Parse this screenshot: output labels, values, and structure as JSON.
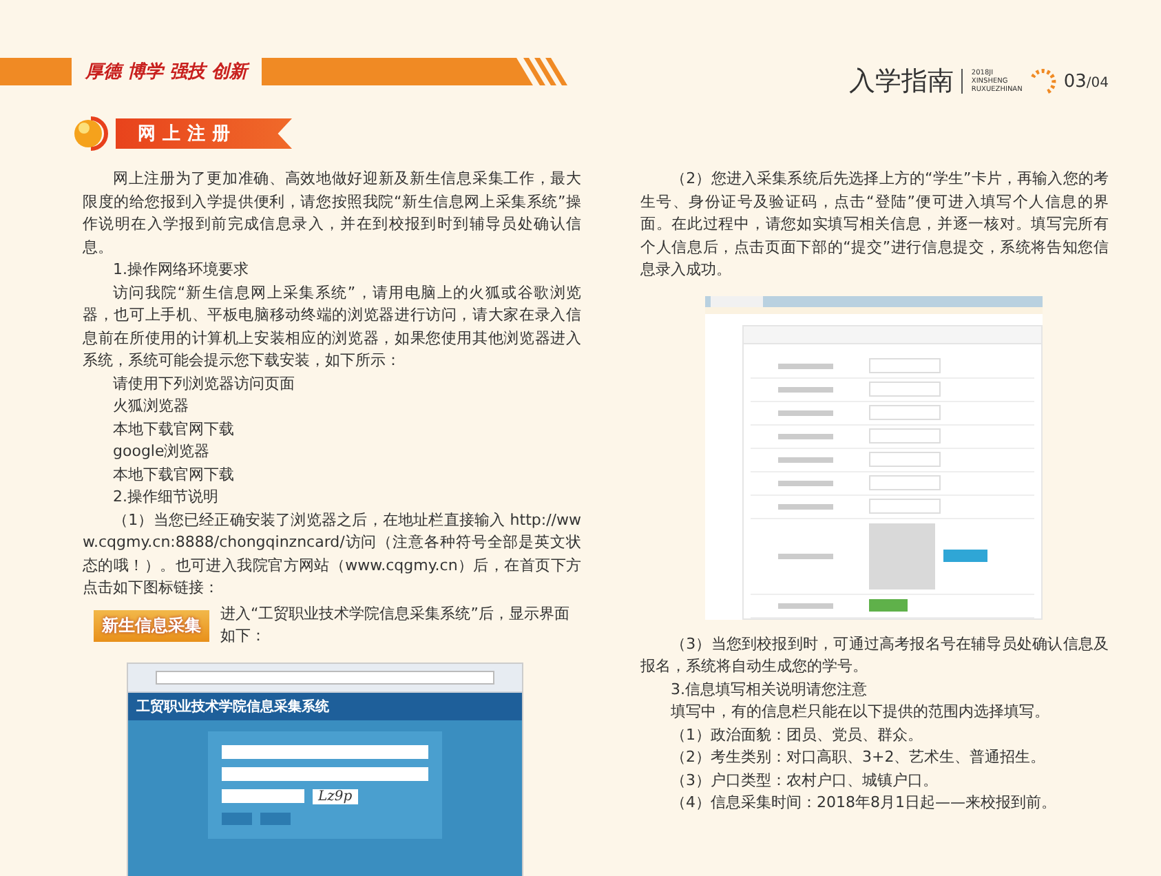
{
  "header": {
    "slogan": "厚德 博学 强技 创新",
    "guide_title": "入学指南",
    "guide_subtitle": [
      "2018JI",
      "XINSHENG",
      "RUXUEZHINAN"
    ],
    "page": "03",
    "page_total": "/04"
  },
  "section_title": "网上注册",
  "left_blocks": [
    {
      "kind": "text",
      "text": "网上注册为了更加准确、高效地做好迎新及新生信息采集工作，最大限度的给您报到入学提供便利，请您按照我院“新生信息网上采集系统”操作说明在入学报到前完成信息录入，并在到校报到时到辅导员处确认信息。"
    },
    {
      "kind": "text",
      "text": "1.操作网络环境要求"
    },
    {
      "kind": "text",
      "text": "访问我院“新生信息网上采集系统”，请用电脑上的火狐或谷歌浏览器，也可上手机、平板电脑移动终端的浏览器进行访问，请大家在录入信息前在所使用的计算机上安装相应的浏览器，如果您使用其他浏览器进入系统，系统可能会提示您下载安装，如下所示："
    },
    {
      "kind": "text",
      "text": "请使用下列浏览器访问页面"
    },
    {
      "kind": "text",
      "text": "火狐浏览器"
    },
    {
      "kind": "text",
      "text": "本地下载官网下载"
    },
    {
      "kind": "text",
      "text": "google浏览器"
    },
    {
      "kind": "text",
      "text": "本地下载官网下载"
    },
    {
      "kind": "text",
      "text": "2.操作细节说明"
    },
    {
      "kind": "image_para",
      "text": "（1）当您已经正确安装了浏览器之后，在地址栏直接输入 http://www.cqgmy.cn:8888/chongqinzncard/访问（注意各种符号全部是英文状态的哦！）。也可进入我院官方网站（www.cqgmy.cn）后，在首页下方点击如下图标链接：",
      "image_label": "新生信息采集",
      "text_after": "进入“工贸职业技术学院信息采集系统”后，显示界面如下："
    }
  ],
  "login_screenshot": {
    "title": "工贸职业技术学院信息采集系统",
    "captcha": "Lz9p"
  },
  "right_blocks_top": [
    {
      "kind": "text",
      "text": "（2）您进入采集系统后先选择上方的“学生”卡片，再输入您的考生号、身份证号及验证码，点击“登陆”便可进入填写个人信息的界面。在此过程中，请您如实填写相关信息，并逐一核对。填写完所有个人信息后，点击页面下部的“提交”进行信息提交，系统将告知您信息录入成功。"
    }
  ],
  "right_blocks_bottom": [
    {
      "kind": "text",
      "text": "（3）当您到校报到时，可通过高考报名号在辅导员处确认信息及报名，系统将自动生成您的学号。"
    },
    {
      "kind": "text",
      "text": "3.信息填写相关说明请您注意"
    },
    {
      "kind": "text",
      "text": "填写中，有的信息栏只能在以下提供的范围内选择填写。"
    },
    {
      "kind": "text",
      "text": "（1）政治面貌：团员、党员、群众。"
    },
    {
      "kind": "text",
      "text": "（2）考生类别：对口高职、3+2、艺术生、普通招生。"
    },
    {
      "kind": "text",
      "text": "（3）户口类型：农村户口、城镇户口。"
    },
    {
      "kind": "text",
      "text": "（4）信息采集时间：2018年8月1日起——来校报到前。"
    }
  ]
}
